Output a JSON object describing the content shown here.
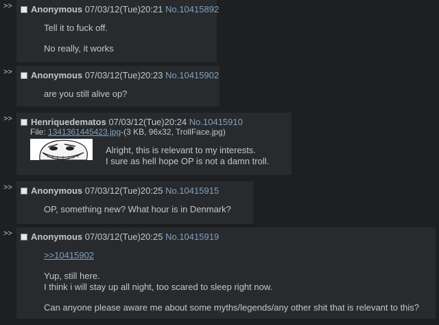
{
  "posts": [
    {
      "arrows": ">>",
      "name": "Anonymous",
      "date": "07/03/12(Tue)20:21",
      "no_prefix": "No.",
      "number": "10415892",
      "lines": [
        "Tell it to fuck off.",
        "No really, it works"
      ]
    },
    {
      "arrows": ">>",
      "name": "Anonymous",
      "date": "07/03/12(Tue)20:23",
      "no_prefix": "No.",
      "number": "10415902",
      "lines": [
        "are you still alive op?"
      ]
    },
    {
      "arrows": ">>",
      "name": "Henriquedematos",
      "date": "07/03/12(Tue)20:24",
      "no_prefix": "No.",
      "number": "10415910",
      "file_label": "File: ",
      "file_name": "1341361445423.jpg",
      "file_meta": "-(3 KB, 96x32, TrollFace.jpg)",
      "lines": [
        "Alright, this is relevant to my interests.",
        "I sure as hell hope OP is not a damn troll."
      ]
    },
    {
      "arrows": ">>",
      "name": "Anonymous",
      "date": "07/03/12(Tue)20:25",
      "no_prefix": "No.",
      "number": "10415915",
      "lines": [
        "OP, something new? What hour is in Denmark?"
      ]
    },
    {
      "arrows": ">>",
      "name": "Anonymous",
      "date": "07/03/12(Tue)20:25",
      "no_prefix": "No.",
      "number": "10415919",
      "quote": ">>10415902",
      "lines": [
        "Yup, still here.",
        "I think i will stay up all night, too scared to sleep right now.",
        "Can anyone please aware me about some myths/legends/any other shit that is relevant to this?"
      ]
    }
  ],
  "colors": {
    "background": "#1d1f21",
    "post": "#282a2e",
    "text": "#c5c8c6",
    "link": "#81a2be"
  }
}
